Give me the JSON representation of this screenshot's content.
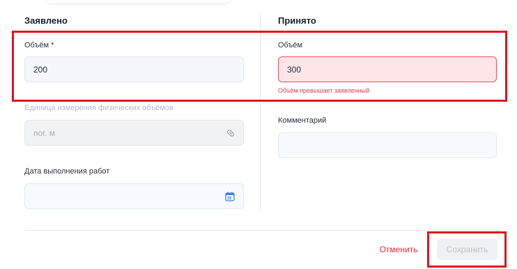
{
  "left_column": {
    "title": "Заявлено",
    "volume": {
      "label": "Объём *",
      "value": "200"
    },
    "unit": {
      "label": "Единица измерения физических объёмов",
      "value": "пог. м",
      "icon": "paperclip-icon"
    },
    "date": {
      "label": "Дата выполнения работ",
      "value": "",
      "icon": "calendar-icon"
    }
  },
  "right_column": {
    "title": "Принято",
    "volume": {
      "label": "Объём",
      "value": "300",
      "error": "Объём превышает заявленный"
    },
    "comment": {
      "label": "Комментарий",
      "value": ""
    }
  },
  "actions": {
    "cancel_label": "Отменить",
    "save_label": "Сохранить"
  },
  "colors": {
    "accent_red": "#e5283a",
    "highlight": "#e0141d",
    "field_bg": "#f4f8fd",
    "error_bg": "#ffe5e8"
  }
}
